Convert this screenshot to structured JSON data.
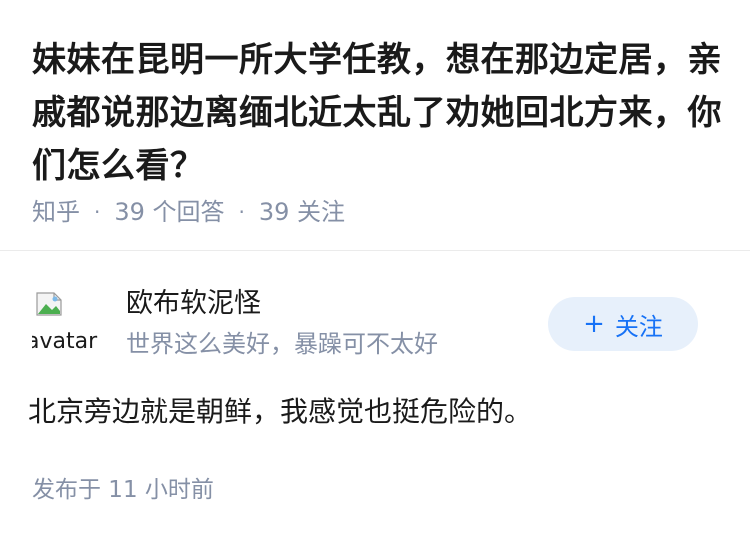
{
  "question": {
    "title": "妹妹在昆明一所大学任教，想在那边定居，亲戚都说那边离缅北近太乱了劝她回北方来，你们怎么看？",
    "source": "知乎",
    "separator": "·",
    "answers_count": "39 个回答",
    "followers_count": "39 关注"
  },
  "answer": {
    "author": {
      "avatar_alt": "avatar",
      "name": "欧布软泥怪",
      "bio": "世界这么美好，暴躁可不太好",
      "follow_button": {
        "icon": "+",
        "label": "关注"
      }
    },
    "content": "北京旁边就是朝鲜，我感觉也挺危险的。",
    "published": "发布于 11 小时前"
  },
  "colors": {
    "title": "#1a1a1a",
    "meta": "#8590a6",
    "accent": "#1772f6",
    "follow_bg": "#e7f0fb",
    "divider": "#ebebeb"
  }
}
